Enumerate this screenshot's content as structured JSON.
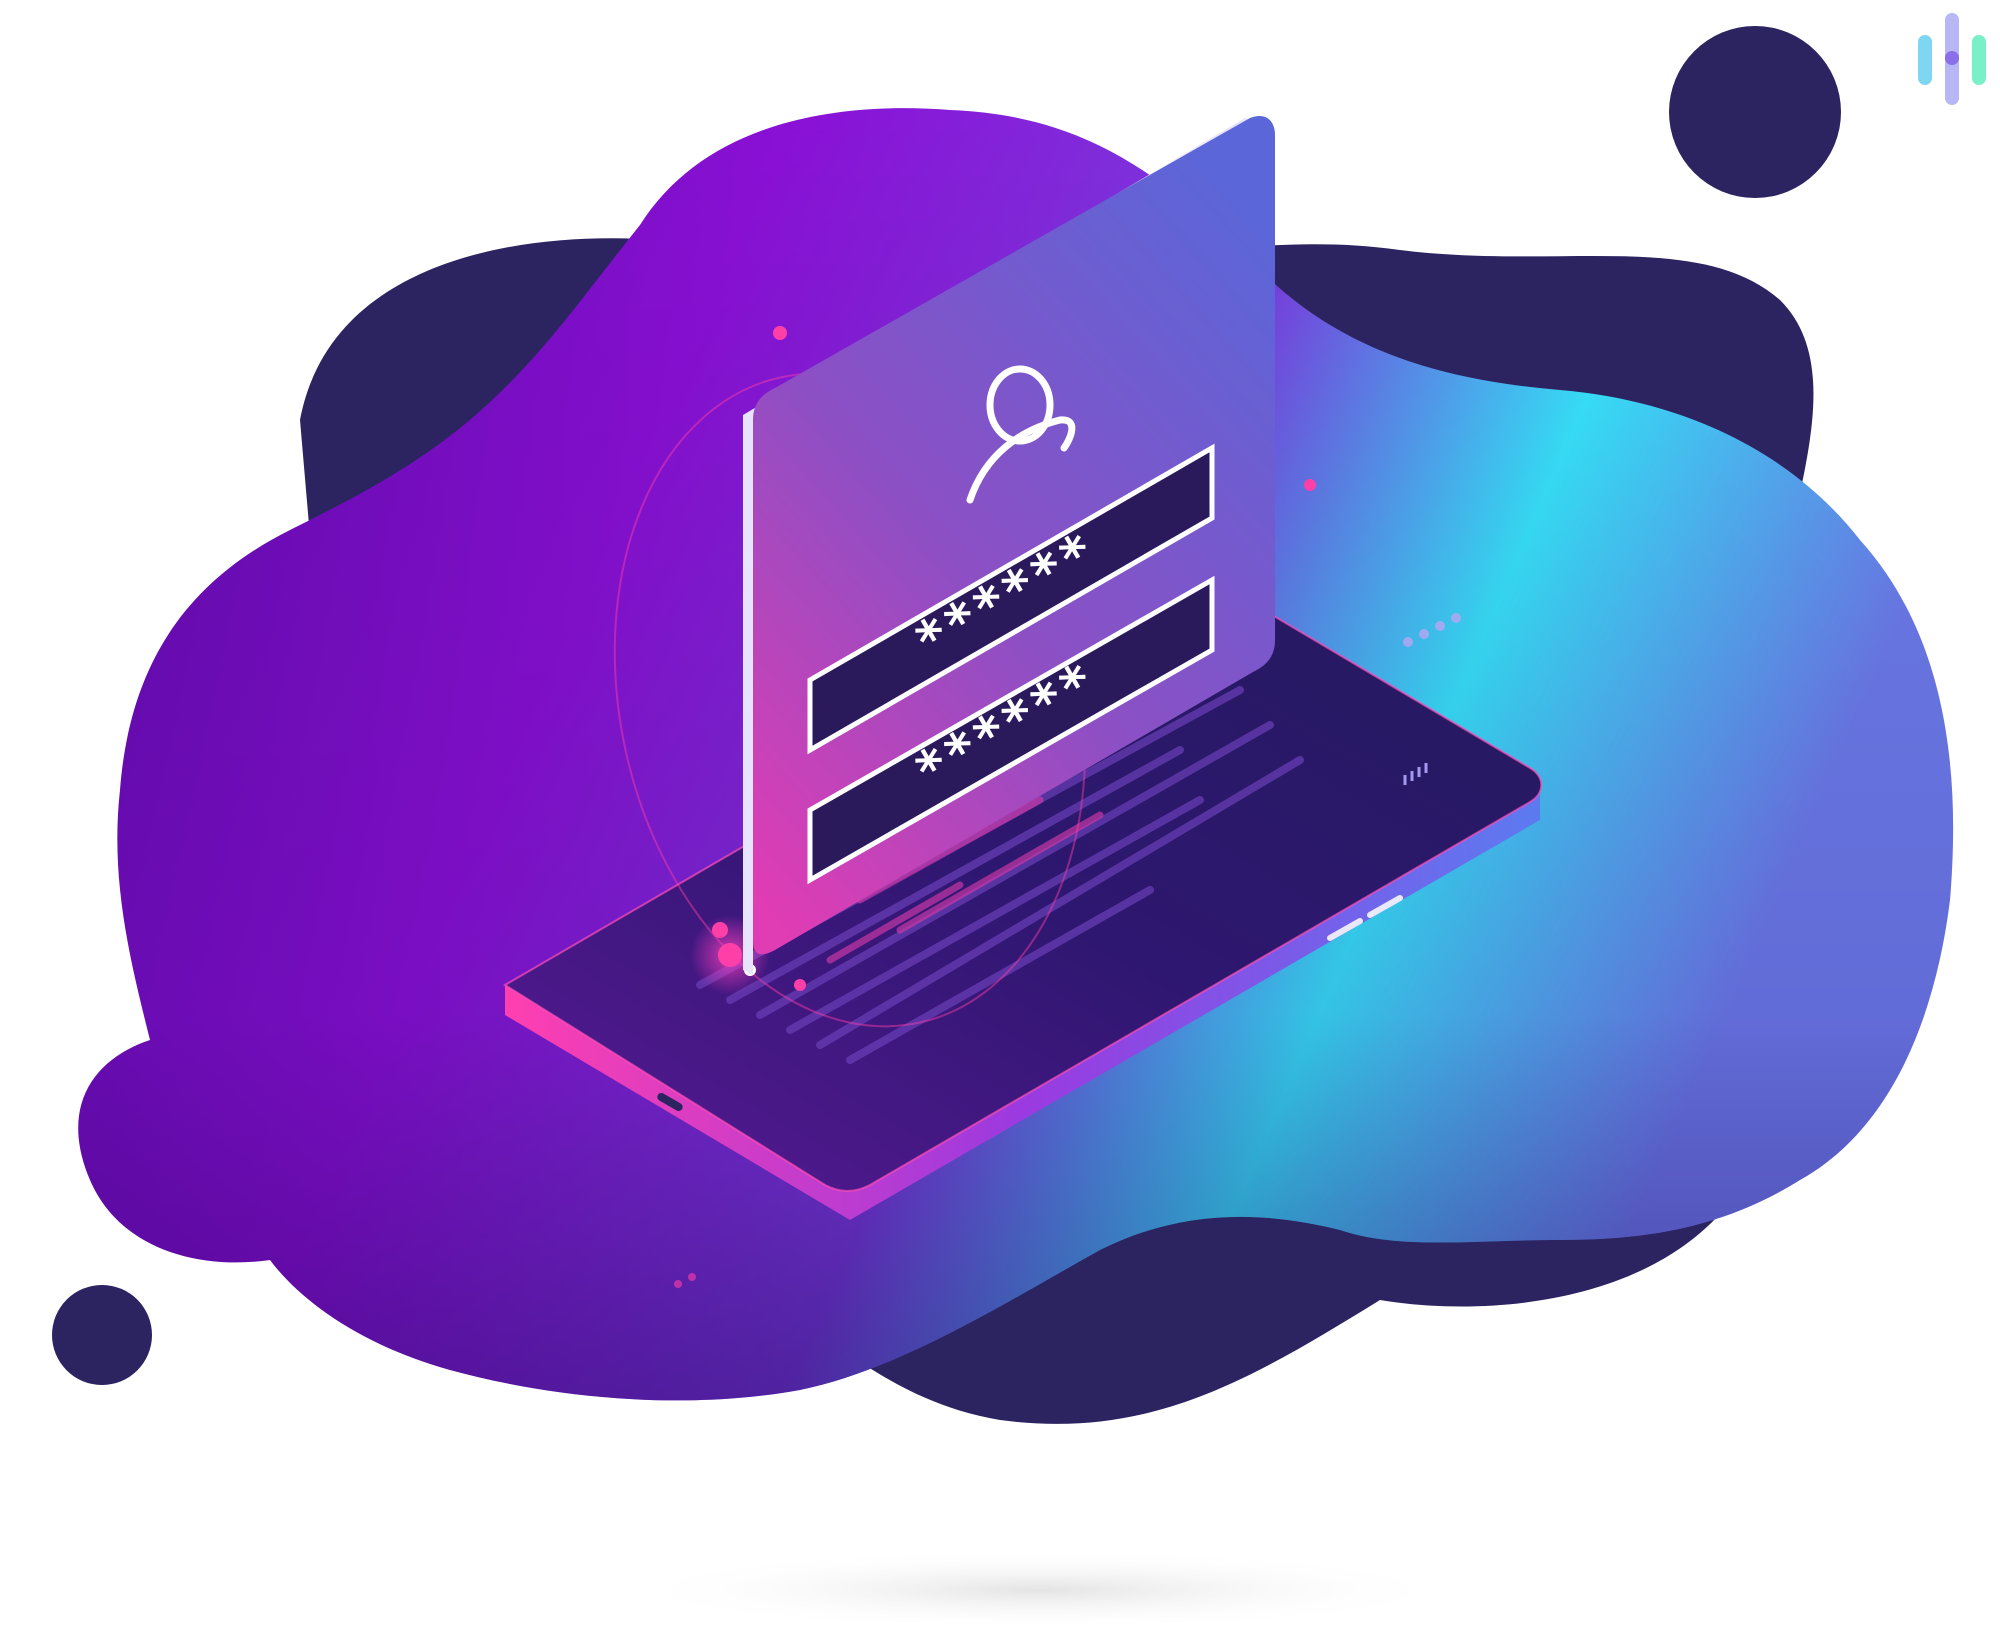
{
  "illustration": {
    "subject": "login",
    "colors": {
      "dark_blob": "#2b2461",
      "purple": "#8a10d6",
      "violet": "#6a0fc4",
      "cyan": "#2ff0ff",
      "magenta": "#ff2fa8",
      "card_top": "#6d6fd8",
      "card_bottom": "#c040b8",
      "field_bg": "#2a1a5c"
    },
    "login_card": {
      "icon": "user-icon",
      "username_field": "******",
      "password_field": "******"
    },
    "logo": {
      "icon": "brand-bars-icon",
      "colors": [
        "#7fd6f0",
        "#b8b6f4",
        "#7af0c8"
      ]
    }
  }
}
